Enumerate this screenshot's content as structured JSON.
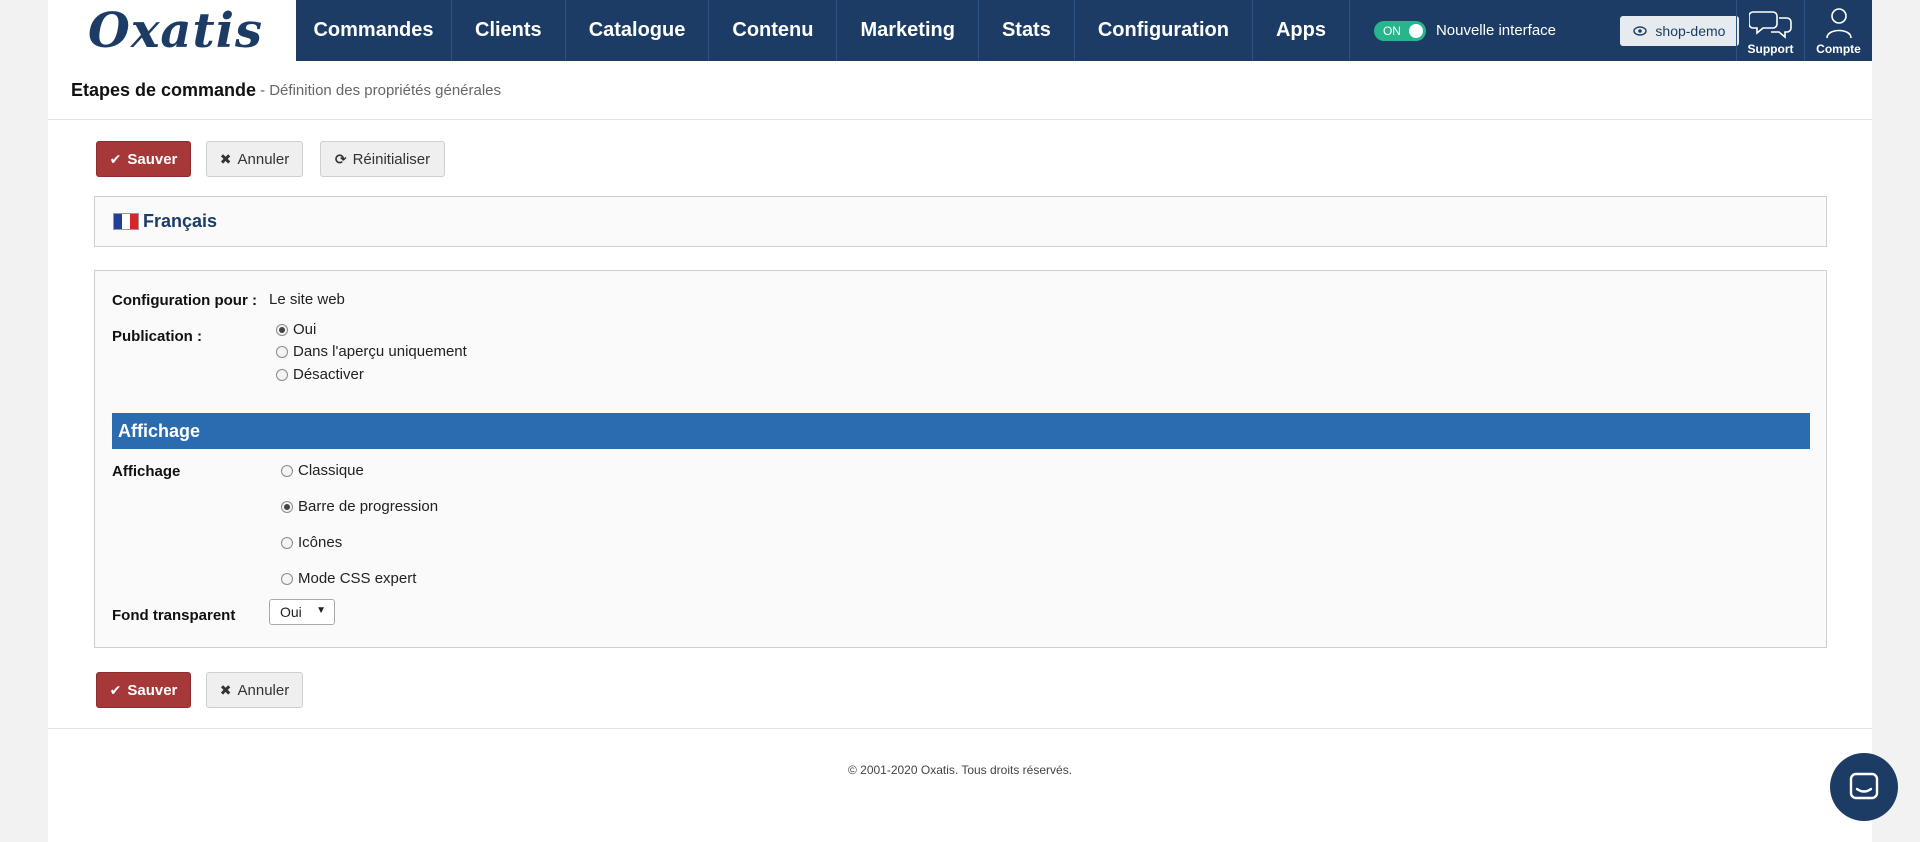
{
  "brand": {
    "logo_text": "Oxatis"
  },
  "nav": {
    "items": [
      {
        "label": "Commandes"
      },
      {
        "label": "Clients"
      },
      {
        "label": "Catalogue"
      },
      {
        "label": "Contenu"
      },
      {
        "label": "Marketing"
      },
      {
        "label": "Stats"
      },
      {
        "label": "Configuration"
      },
      {
        "label": "Apps"
      }
    ],
    "toggle_state": "ON",
    "toggle_label": "Nouvelle interface",
    "shop_label": "shop-demo",
    "support_label": "Support",
    "account_label": "Compte"
  },
  "header": {
    "title": "Etapes de commande",
    "subtitle": "- Définition des propriétés générales"
  },
  "toolbar": {
    "save_label": "Sauver",
    "cancel_label": "Annuler",
    "reset_label": "Réinitialiser"
  },
  "language": {
    "label": "Français"
  },
  "form": {
    "config_label": "Configuration pour :",
    "config_value": "Le site web",
    "publication_label": "Publication :",
    "publication_options": [
      "Oui",
      "Dans l'aperçu uniquement",
      "Désactiver"
    ],
    "publication_selected": 0,
    "section_title": "Affichage",
    "display_label": "Affichage",
    "display_options": [
      "Classique",
      "Barre de progression",
      "Icônes",
      "Mode CSS expert"
    ],
    "display_selected": 1,
    "transparent_label": "Fond transparent",
    "transparent_value": "Oui"
  },
  "bottom_toolbar": {
    "save_label": "Sauver",
    "cancel_label": "Annuler"
  },
  "footer": {
    "copyright": "© 2001-2020 Oxatis. Tous droits réservés."
  },
  "colors": {
    "nav_bg": "#1d3c65",
    "save_btn": "#a6383a",
    "section_bar": "#2b6cb0",
    "toggle_on": "#28b48c"
  }
}
